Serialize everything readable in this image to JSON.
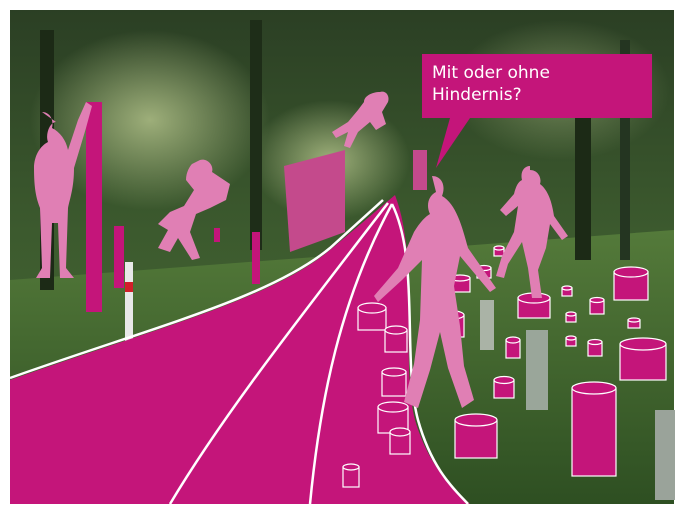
{
  "speech_bubble": {
    "line1": "Mit oder ohne",
    "line2": "Hindernis?"
  },
  "colors": {
    "magenta": "#c4157a",
    "pink_figure": "#e07fb4",
    "pink_panel": "#c44a8c",
    "foliage_dark": "#1f3a1e",
    "grass": "#3f6b2e"
  }
}
